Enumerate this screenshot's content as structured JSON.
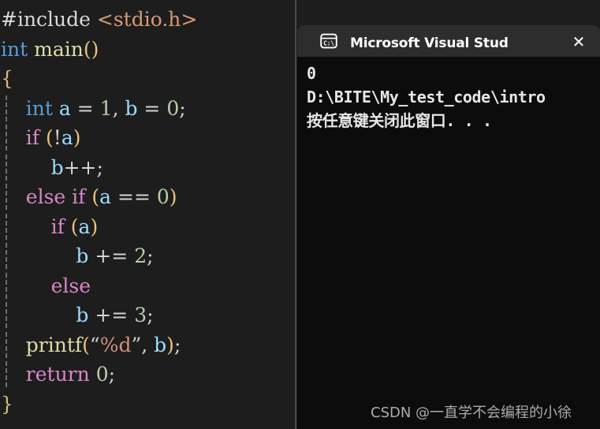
{
  "editor": {
    "name": "c-source-editor",
    "background": "#1d1d1d",
    "lines": [
      {
        "indent": false,
        "tokens": [
          {
            "t": "#include",
            "c": "c-pre"
          },
          {
            "t": " ",
            "c": "c-plain"
          },
          {
            "t": "<stdio.h>",
            "c": "c-header"
          }
        ]
      },
      {
        "indent": false,
        "tokens": [
          {
            "t": "int",
            "c": "c-type"
          },
          {
            "t": " ",
            "c": "c-plain"
          },
          {
            "t": "main",
            "c": "c-func"
          },
          {
            "t": "()",
            "c": "c-paren"
          }
        ]
      },
      {
        "indent": false,
        "tokens": [
          {
            "t": "{",
            "c": "c-brace"
          }
        ]
      },
      {
        "indent": true,
        "tokens": [
          {
            "t": "    ",
            "c": "c-plain"
          },
          {
            "t": "int",
            "c": "c-type"
          },
          {
            "t": " ",
            "c": "c-plain"
          },
          {
            "t": "a",
            "c": "c-var"
          },
          {
            "t": " = ",
            "c": "c-op"
          },
          {
            "t": "1",
            "c": "c-num"
          },
          {
            "t": ", ",
            "c": "c-op"
          },
          {
            "t": "b",
            "c": "c-var"
          },
          {
            "t": " = ",
            "c": "c-op"
          },
          {
            "t": "0",
            "c": "c-num"
          },
          {
            "t": ";",
            "c": "c-op"
          }
        ]
      },
      {
        "indent": true,
        "tokens": [
          {
            "t": "    ",
            "c": "c-plain"
          },
          {
            "t": "if",
            "c": "c-kw"
          },
          {
            "t": " ",
            "c": "c-plain"
          },
          {
            "t": "(",
            "c": "c-paren"
          },
          {
            "t": "!",
            "c": "c-op"
          },
          {
            "t": "a",
            "c": "c-var"
          },
          {
            "t": ")",
            "c": "c-paren"
          }
        ]
      },
      {
        "indent": true,
        "tokens": [
          {
            "t": "        ",
            "c": "c-plain"
          },
          {
            "t": "b",
            "c": "c-var"
          },
          {
            "t": "++;",
            "c": "c-op"
          }
        ]
      },
      {
        "indent": true,
        "tokens": [
          {
            "t": "    ",
            "c": "c-plain"
          },
          {
            "t": "else if",
            "c": "c-kw"
          },
          {
            "t": " ",
            "c": "c-plain"
          },
          {
            "t": "(",
            "c": "c-paren"
          },
          {
            "t": "a",
            "c": "c-var"
          },
          {
            "t": " == ",
            "c": "c-op"
          },
          {
            "t": "0",
            "c": "c-num"
          },
          {
            "t": ")",
            "c": "c-paren"
          }
        ]
      },
      {
        "indent": true,
        "tokens": [
          {
            "t": "        ",
            "c": "c-plain"
          },
          {
            "t": "if",
            "c": "c-kw"
          },
          {
            "t": " ",
            "c": "c-plain"
          },
          {
            "t": "(",
            "c": "c-paren"
          },
          {
            "t": "a",
            "c": "c-var"
          },
          {
            "t": ")",
            "c": "c-paren"
          }
        ]
      },
      {
        "indent": true,
        "tokens": [
          {
            "t": "            ",
            "c": "c-plain"
          },
          {
            "t": "b",
            "c": "c-var"
          },
          {
            "t": " += ",
            "c": "c-op"
          },
          {
            "t": "2",
            "c": "c-num"
          },
          {
            "t": ";",
            "c": "c-op"
          }
        ]
      },
      {
        "indent": true,
        "tokens": [
          {
            "t": "        ",
            "c": "c-plain"
          },
          {
            "t": "else",
            "c": "c-kw"
          }
        ]
      },
      {
        "indent": true,
        "tokens": [
          {
            "t": "            ",
            "c": "c-plain"
          },
          {
            "t": "b",
            "c": "c-var"
          },
          {
            "t": " += ",
            "c": "c-op"
          },
          {
            "t": "3",
            "c": "c-num"
          },
          {
            "t": ";",
            "c": "c-op"
          }
        ]
      },
      {
        "indent": true,
        "tokens": [
          {
            "t": "    ",
            "c": "c-plain"
          },
          {
            "t": "printf",
            "c": "c-func"
          },
          {
            "t": "(",
            "c": "c-paren"
          },
          {
            "t": "“",
            "c": "c-plain"
          },
          {
            "t": "%d",
            "c": "c-str"
          },
          {
            "t": "”",
            "c": "c-plain"
          },
          {
            "t": ", ",
            "c": "c-op"
          },
          {
            "t": "b",
            "c": "c-var"
          },
          {
            "t": ")",
            "c": "c-paren"
          },
          {
            "t": ";",
            "c": "c-op"
          }
        ]
      },
      {
        "indent": true,
        "tokens": [
          {
            "t": "    ",
            "c": "c-plain"
          },
          {
            "t": "return",
            "c": "c-kw"
          },
          {
            "t": " ",
            "c": "c-plain"
          },
          {
            "t": "0",
            "c": "c-num"
          },
          {
            "t": ";",
            "c": "c-op"
          }
        ]
      },
      {
        "indent": false,
        "tokens": [
          {
            "t": "}",
            "c": "c-brace"
          }
        ]
      }
    ]
  },
  "console": {
    "title": "Microsoft Visual Studio 调试挂",
    "icon_label": "C:\\",
    "close_label": "✕",
    "titlebar_color": "#2d2d2d",
    "body_color": "#0c0c0c",
    "output_lines": [
      "0",
      "D:\\BITE\\My_test_code\\intro",
      "按任意键关闭此窗口. . ."
    ]
  },
  "watermark": {
    "text": "CSDN @一直学不会编程的小徐"
  }
}
